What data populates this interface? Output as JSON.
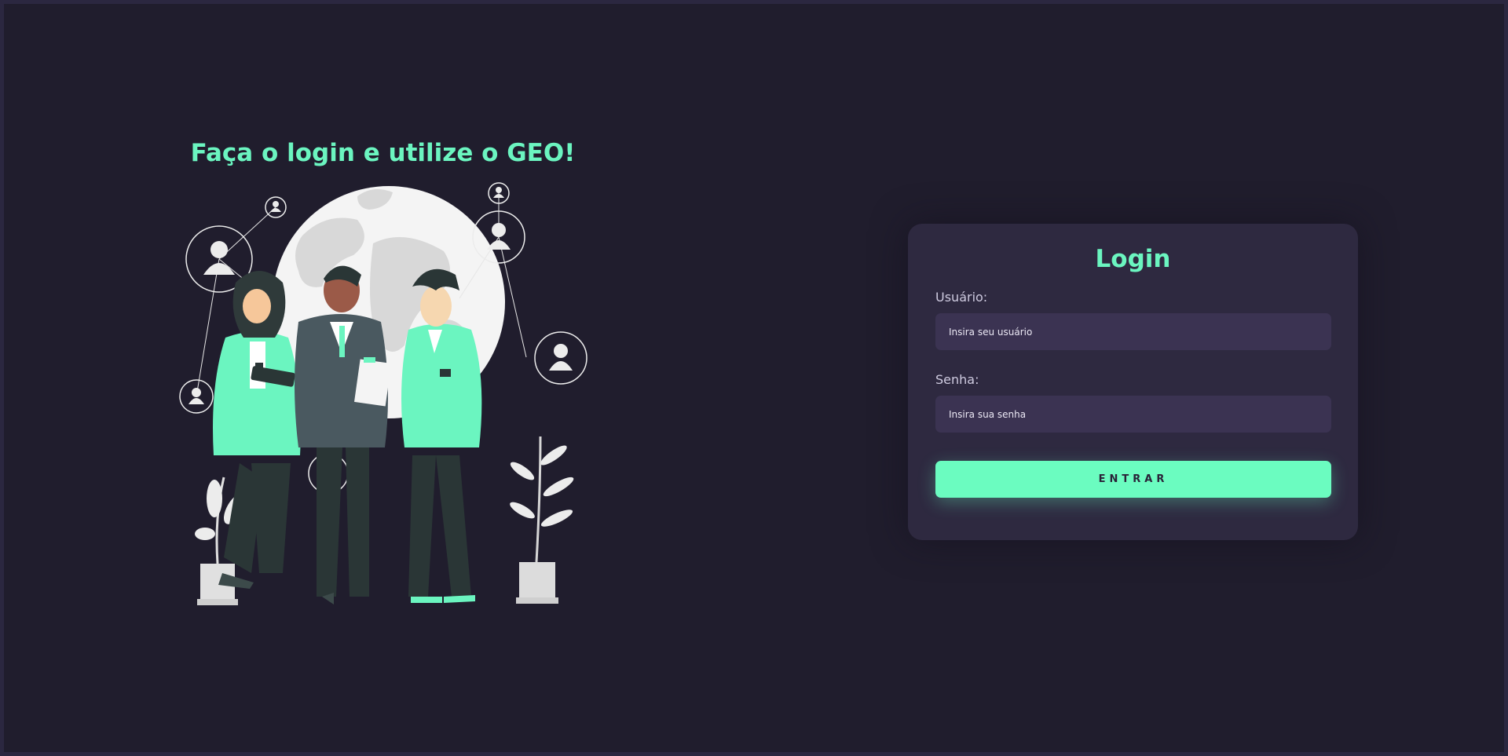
{
  "hero": {
    "title": "Faça o login e utilize o GEO!"
  },
  "login": {
    "title": "Login",
    "username_label": "Usuário:",
    "username_placeholder": "Insira seu usuário",
    "password_label": "Senha:",
    "password_placeholder": "Insira sua senha",
    "submit_label": "ENTRAR"
  },
  "colors": {
    "background": "#201d2d",
    "card": "#2e2940",
    "input": "#3b3352",
    "accent": "#6bf5c0"
  },
  "icons": [
    "user-avatar-icon",
    "globe-icon",
    "plant-icon"
  ]
}
